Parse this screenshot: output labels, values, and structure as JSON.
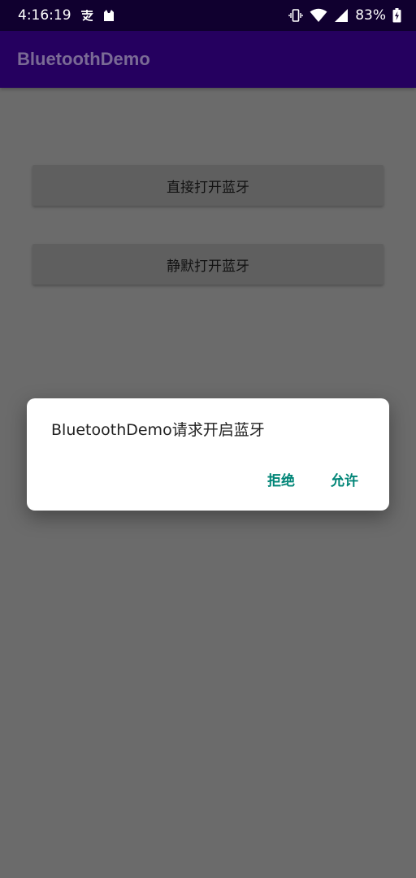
{
  "status_bar": {
    "time": "4:16:19",
    "battery_percent": "83%",
    "icons_left": [
      "alipay-icon",
      "cat-icon"
    ],
    "icons_right": [
      "vibrate-icon",
      "wifi-icon",
      "signal-icon",
      "battery-charging-icon"
    ]
  },
  "app_bar": {
    "title": "BluetoothDemo",
    "color": "#25005f"
  },
  "main": {
    "buttons": [
      {
        "label": "直接打开蓝牙"
      },
      {
        "label": "静默打开蓝牙"
      }
    ]
  },
  "dialog": {
    "message": "BluetoothDemo请求开启蓝牙",
    "deny_label": "拒绝",
    "allow_label": "允许",
    "accent_color": "#008577"
  }
}
